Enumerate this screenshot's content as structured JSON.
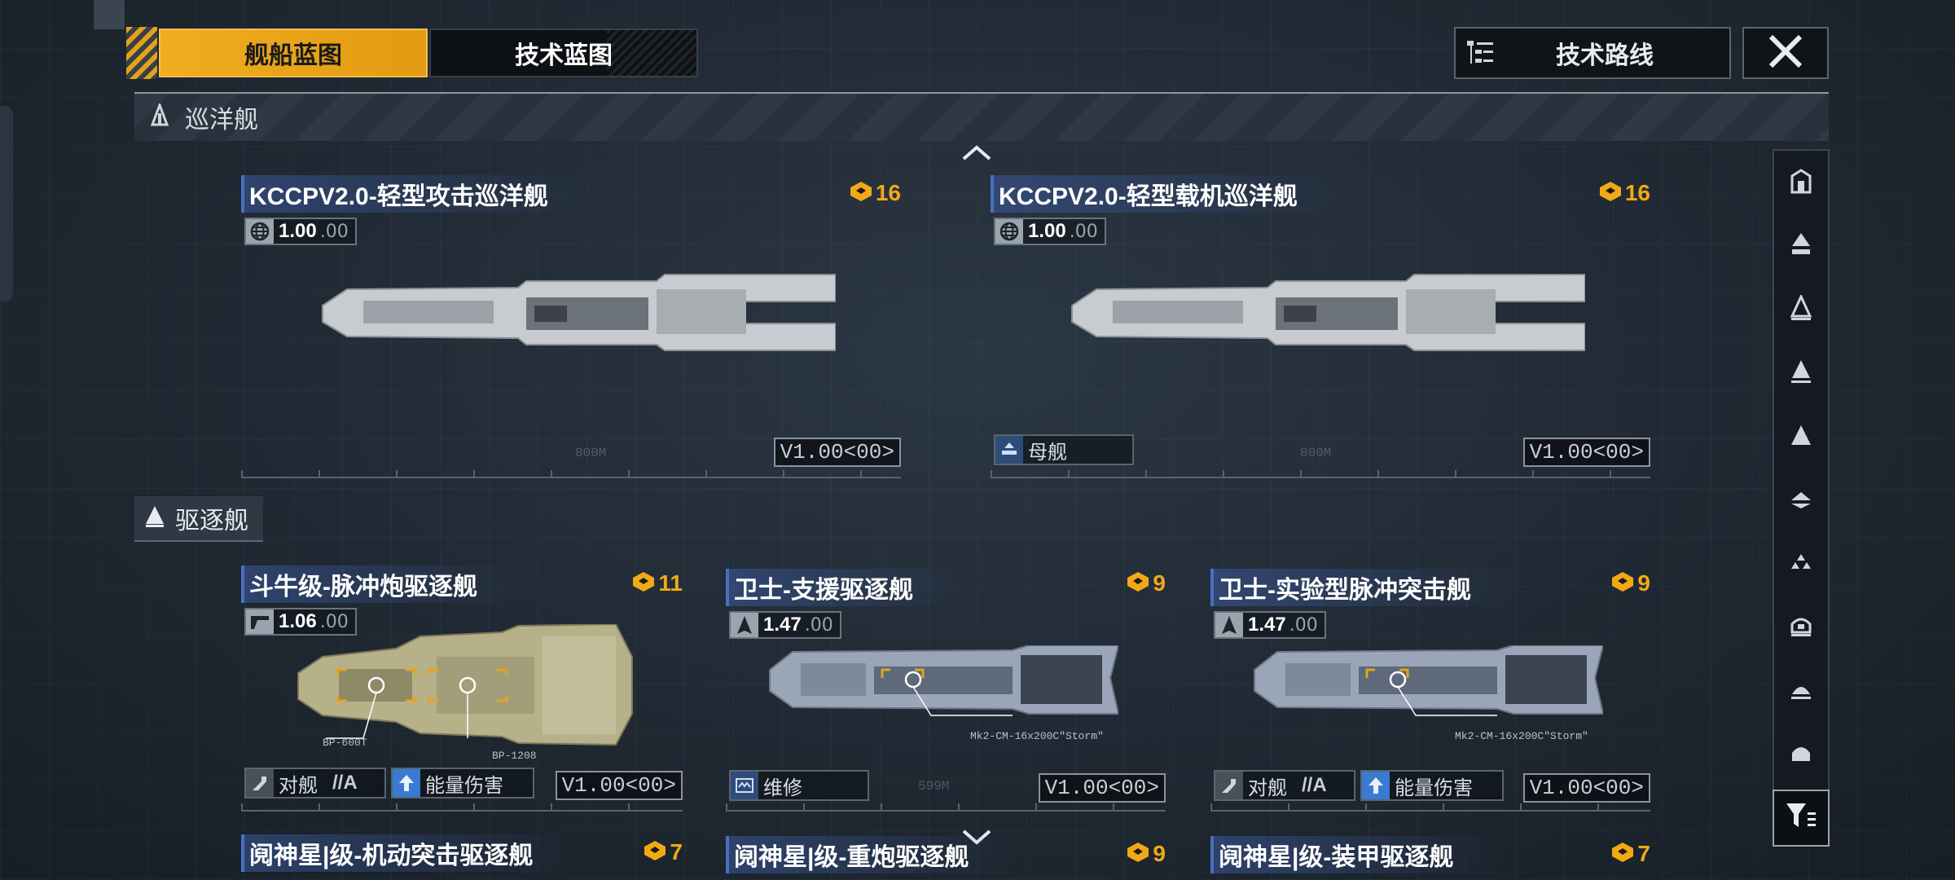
{
  "tabs": {
    "ship_blueprint": "舰船蓝图",
    "tech_blueprint": "技术蓝图"
  },
  "tech_route_label": "技术路线",
  "section_cruiser": "巡洋舰",
  "section_destroyer": "驱逐舰",
  "cards": [
    {
      "title": "KCCPV2.0-轻型攻击巡洋舰",
      "cost": "16",
      "badge_main": "1.00",
      "badge_sub": ".00",
      "version": "V1.00<00>",
      "tags": []
    },
    {
      "title": "KCCPV2.0-轻型载机巡洋舰",
      "cost": "16",
      "badge_main": "1.00",
      "badge_sub": ".00",
      "version": "V1.00<00>",
      "tags": [
        {
          "label": "母舰",
          "grade": ""
        }
      ]
    },
    {
      "title": "斗牛级-脉冲炮驱逐舰",
      "cost": "11",
      "badge_main": "1.06",
      "badge_sub": ".00",
      "version": "V1.00<00>",
      "callouts": [
        "BP-600T",
        "BP-1208"
      ],
      "tags": [
        {
          "label": "对舰",
          "grade": "//A"
        },
        {
          "label": "能量伤害",
          "grade": ""
        }
      ]
    },
    {
      "title": "卫士-支援驱逐舰",
      "cost": "9",
      "badge_main": "1.47",
      "badge_sub": ".00",
      "version": "V1.00<00>",
      "callouts": [
        "Mk2-CM-16x200C\"Storm\""
      ],
      "tags": [
        {
          "label": "维修",
          "grade": ""
        }
      ]
    },
    {
      "title": "卫士-实验型脉冲突击舰",
      "cost": "9",
      "badge_main": "1.47",
      "badge_sub": ".00",
      "version": "V1.00<00>",
      "callouts": [
        "Mk2-CM-16x200C\"Storm\""
      ],
      "tags": [
        {
          "label": "对舰",
          "grade": "//A"
        },
        {
          "label": "能量伤害",
          "grade": ""
        }
      ]
    },
    {
      "title": "阋神星|级-机动突击驱逐舰",
      "cost": "7"
    },
    {
      "title": "阋神星|级-重炮驱逐舰",
      "cost": "9"
    },
    {
      "title": "阋神星|级-装甲驱逐舰",
      "cost": "7"
    }
  ],
  "faint_labels": [
    "800M",
    "800M",
    "599M"
  ],
  "colors": {
    "accent": "#f0ad1e",
    "cost": "#f2a916",
    "title_bar": "#4a6fc0",
    "background": "#202a34"
  },
  "filter_icons": [
    "hangar-icon",
    "carrier-icon",
    "cruiser-icon",
    "destroyer-icon",
    "frigate-icon",
    "corvette-icon",
    "fighter-group-icon",
    "station-icon",
    "dome-icon",
    "shield-icon"
  ]
}
